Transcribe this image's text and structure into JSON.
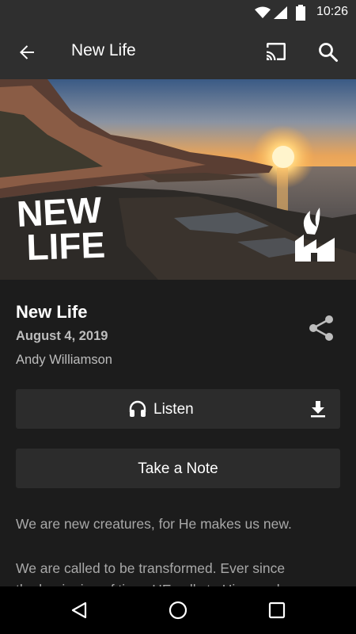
{
  "status_bar": {
    "time": "10:26"
  },
  "app_bar": {
    "title": "New Life"
  },
  "hero": {
    "overlay_text_line1": "NEW",
    "overlay_text_line2": "LIFE"
  },
  "sermon": {
    "title": "New Life",
    "date": "August 4, 2019",
    "speaker": "Andy Williamson"
  },
  "actions": {
    "listen_label": "Listen",
    "note_label": "Take a Note"
  },
  "description": {
    "paragraph1": "We are new creatures, for He makes us new.",
    "paragraph2_line1": "We are called to be transformed. Ever since",
    "paragraph2_line2": "the beginning of time, HE calls to His people"
  },
  "colors": {
    "app_bar": "#2f2f2f",
    "background": "#1c1c1c",
    "button": "#2c2c2c"
  }
}
